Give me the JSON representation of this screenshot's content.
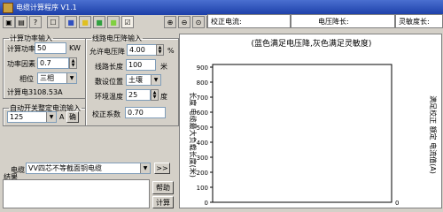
{
  "window": {
    "title": "电缆计算程序 V1.1"
  },
  "toolbar": {
    "icons": [
      "save-icon",
      "save-as-icon",
      "help-icon",
      "checkbox-icon",
      "swatch-blue-icon",
      "swatch-yellow-icon",
      "swatch-green-icon",
      "swatch-lime-icon",
      "checked-icon",
      "zoom-in-icon",
      "zoom-out-icon",
      "zoom-fit-icon",
      "zoom-window-icon",
      "pan-icon"
    ]
  },
  "header": {
    "field1": "校正电流:",
    "field2": "电压降长:",
    "field3": "灵敏度长:"
  },
  "power_group": {
    "legend": "计算功率输入",
    "power_label": "计算功率",
    "power_value": "50",
    "power_unit": "KW",
    "pf_label": "功率因素",
    "pf_value": "0.7",
    "phase_label": "相位",
    "phase_value": "三相",
    "current_text": "计算电3108.53A"
  },
  "switch_group": {
    "legend": "自动开关整定电流输入",
    "current_value": "125",
    "unit": "A",
    "confirm_label": "确"
  },
  "vdrop_group": {
    "legend": "线路电压降输入",
    "allow_label": "允许电压降",
    "allow_value": "4.00",
    "allow_unit": "%",
    "length_label": "线路长度",
    "length_value": "100",
    "length_unit": "米",
    "laying_label": "敷设位置",
    "laying_value": "土壤",
    "temp_label": "环境温度",
    "temp_value": "25",
    "temp_unit": "度",
    "corr_label": "校正系数",
    "corr_value": "0.70"
  },
  "cable": {
    "label": "电缆",
    "value": "VV四芯不等截面铜电缆",
    "more_label": ">>"
  },
  "result": {
    "label": "结果",
    "help_label": "帮助",
    "calc_label": "计算"
  },
  "chart_data": {
    "type": "line",
    "title": "(蓝色满足电压降,灰色满足灵敏度)",
    "ylabel": "长度 电缆最大负载长度(米)",
    "y2label": "满足校正 额定 电流值(A)",
    "ylim": [
      0,
      900
    ],
    "yticks": [
      "900",
      "800",
      "700",
      "600",
      "500",
      "400",
      "300",
      "200",
      "100",
      "0"
    ],
    "y2ticks": [
      "0"
    ],
    "series": []
  }
}
